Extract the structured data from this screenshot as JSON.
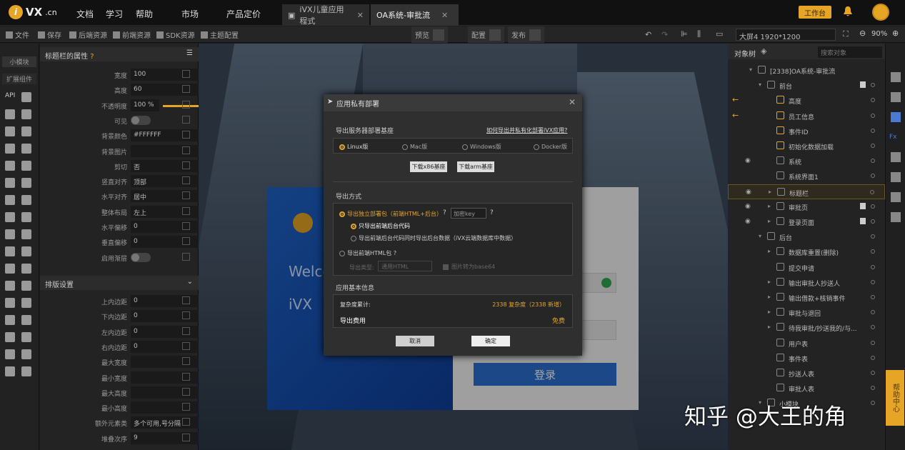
{
  "topbar": {
    "brand": "VX",
    "brand_suffix": ".cn",
    "nav": [
      "文档",
      "学习",
      "帮助",
      "市场",
      "产品定价"
    ],
    "tabs": [
      {
        "label": "iVX儿童应用程式",
        "active": false
      },
      {
        "label": "OA系统-审批流",
        "active": true
      }
    ],
    "workspace_button": "工作台"
  },
  "toolbar": {
    "file": "文件",
    "save": "保存",
    "backend": "后端资源",
    "frontend": "前端资源",
    "sdk": "SDK资源",
    "theme": "主题配置",
    "preview": "预览",
    "config": "配置",
    "publish": "发布",
    "resolution": "大屏4 1920*1200",
    "zoom": "90%"
  },
  "left_strip": {
    "tab_small": "小模块",
    "tab_ext": "扩展组件",
    "api": "API"
  },
  "props": {
    "section_title": "标题栏的属性",
    "rows": [
      {
        "label": "宽度",
        "value": "100",
        "unit": "%"
      },
      {
        "label": "高度",
        "value": "60",
        "unit": "px"
      },
      {
        "label": "不透明度",
        "value": "100 %",
        "unit": ""
      },
      {
        "label": "可见",
        "value": "",
        "unit": ""
      },
      {
        "label": "背景颜色",
        "value": "#FFFFFF",
        "unit": ""
      },
      {
        "label": "背景图片",
        "value": "",
        "unit": ""
      },
      {
        "label": "剪切",
        "value": "否",
        "unit": ""
      },
      {
        "label": "竖直对齐",
        "value": "顶部",
        "unit": ""
      },
      {
        "label": "水平对齐",
        "value": "居中",
        "unit": ""
      },
      {
        "label": "整体布局",
        "value": "左上",
        "unit": ""
      },
      {
        "label": "水平偏移",
        "value": "0",
        "unit": ""
      },
      {
        "label": "垂直偏移",
        "value": "0",
        "unit": ""
      },
      {
        "label": "启用渐层",
        "value": "",
        "unit": ""
      }
    ],
    "layout_title": "排版设置",
    "layout_rows": [
      {
        "label": "上内边距",
        "value": "0",
        "unit": ""
      },
      {
        "label": "下内边距",
        "value": "0",
        "unit": ""
      },
      {
        "label": "左内边距",
        "value": "0",
        "unit": ""
      },
      {
        "label": "右内边距",
        "value": "0",
        "unit": ""
      },
      {
        "label": "最大宽度",
        "value": "",
        "unit": "px"
      },
      {
        "label": "最小宽度",
        "value": "",
        "unit": "px"
      },
      {
        "label": "最大高度",
        "value": "",
        "unit": "px"
      },
      {
        "label": "最小高度",
        "value": "",
        "unit": "px"
      },
      {
        "label": "额外元素类",
        "value": "多个可用,号分隔",
        "unit": ""
      },
      {
        "label": "堆叠次序",
        "value": "9",
        "unit": ""
      }
    ]
  },
  "canvas": {
    "welcome": "Welco",
    "ivx": "iVX",
    "login": "登录"
  },
  "modal": {
    "title": "应用私有部署",
    "server_section": "导出服务器部署基座",
    "how_link": "如何导出并私有化部署iVX应用?",
    "os_options": [
      "Linux版",
      "Mac版",
      "Windows版",
      "Docker版"
    ],
    "download_x86": "下载x86基座",
    "download_arm": "下载arm基座",
    "export_section": "导出方式",
    "opt_standalone": "导出独立部署包（前端HTML+后台）",
    "key_placeholder": "加密key",
    "opt_frontend_only": "只导出前端后台代码",
    "opt_with_data": "导出前端后台代码同时导出后台数据（iVX云端数据库中数据）",
    "opt_html": "导出前端HTML包",
    "export_type_label": "导出类型:",
    "export_type_value": "通用HTML",
    "img_base64": "图片转为base64",
    "basic_section": "应用基本信息",
    "complexity_label": "复杂度累计:",
    "complexity_value": "2338 复杂度（2338 新增）",
    "fee_label": "导出费用",
    "fee_value": "免费",
    "cancel": "取消",
    "confirm": "确定"
  },
  "right_panel": {
    "title": "对象树",
    "search_placeholder": "搜索对象",
    "tree": [
      {
        "label": "[2338]OA系统-审批流",
        "indent": 0
      },
      {
        "label": "前台",
        "indent": 1
      },
      {
        "label": "高度",
        "indent": 2
      },
      {
        "label": "员工信息",
        "indent": 2
      },
      {
        "label": "事件ID",
        "indent": 2
      },
      {
        "label": "初始化数据加载",
        "indent": 2
      },
      {
        "label": "系统",
        "indent": 2
      },
      {
        "label": "系统界面1",
        "indent": 2
      },
      {
        "label": "标题栏",
        "indent": 2
      },
      {
        "label": "审批页",
        "indent": 2
      },
      {
        "label": "登录页面",
        "indent": 2
      },
      {
        "label": "后台",
        "indent": 1
      },
      {
        "label": "数据库重置(删除)",
        "indent": 2
      },
      {
        "label": "提交申请",
        "indent": 2
      },
      {
        "label": "输出审批人抄送人",
        "indent": 2
      },
      {
        "label": "输出借款+核销事件",
        "indent": 2
      },
      {
        "label": "审批与退回",
        "indent": 2
      },
      {
        "label": "待我审批/抄送我的/与...",
        "indent": 2
      },
      {
        "label": "用户表",
        "indent": 2
      },
      {
        "label": "事件表",
        "indent": 2
      },
      {
        "label": "抄送人表",
        "indent": 2
      },
      {
        "label": "审批人表",
        "indent": 2
      },
      {
        "label": "小模块",
        "indent": 1
      }
    ]
  },
  "help_center": "帮助中心",
  "watermark": "知乎 @大王的角",
  "colors": {
    "accent": "#e7a526",
    "primary_blue": "#2d6fd1"
  }
}
